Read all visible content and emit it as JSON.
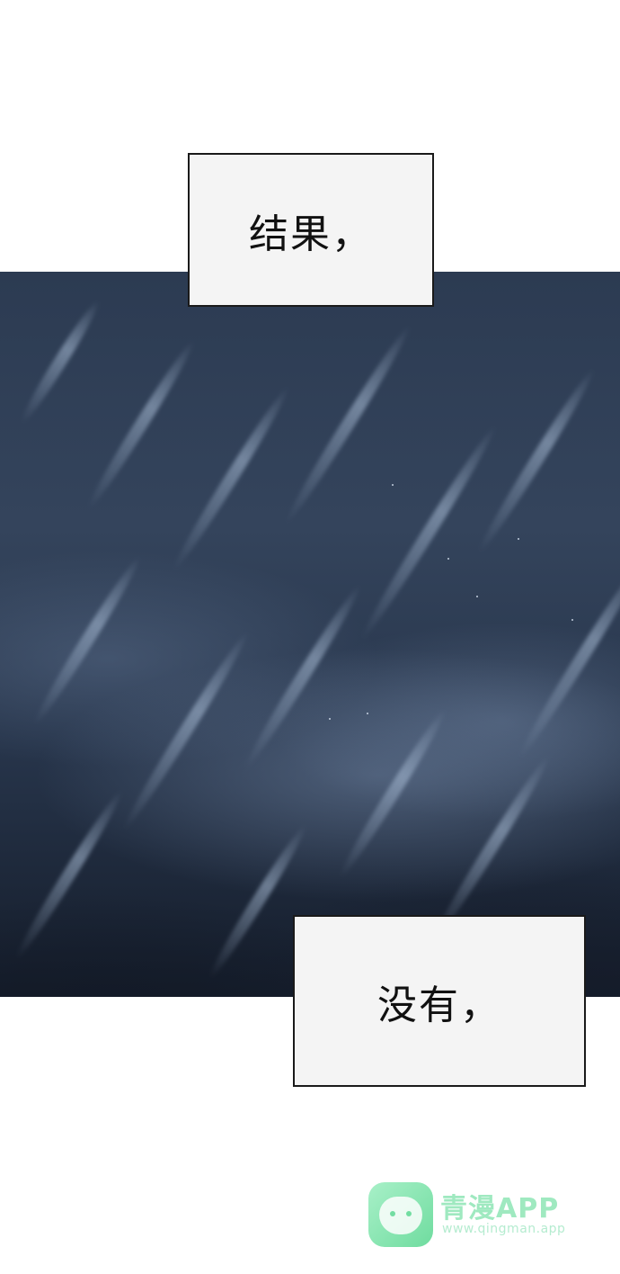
{
  "captions": {
    "top": "结果，",
    "bottom": "没有，"
  },
  "watermark": {
    "name": "青漫APP",
    "url": "www.qingman.app",
    "icon": "cat-face-icon",
    "color": "#9fe9c0"
  },
  "scene": {
    "description_icon": "rainy-night-sky-illustration"
  }
}
